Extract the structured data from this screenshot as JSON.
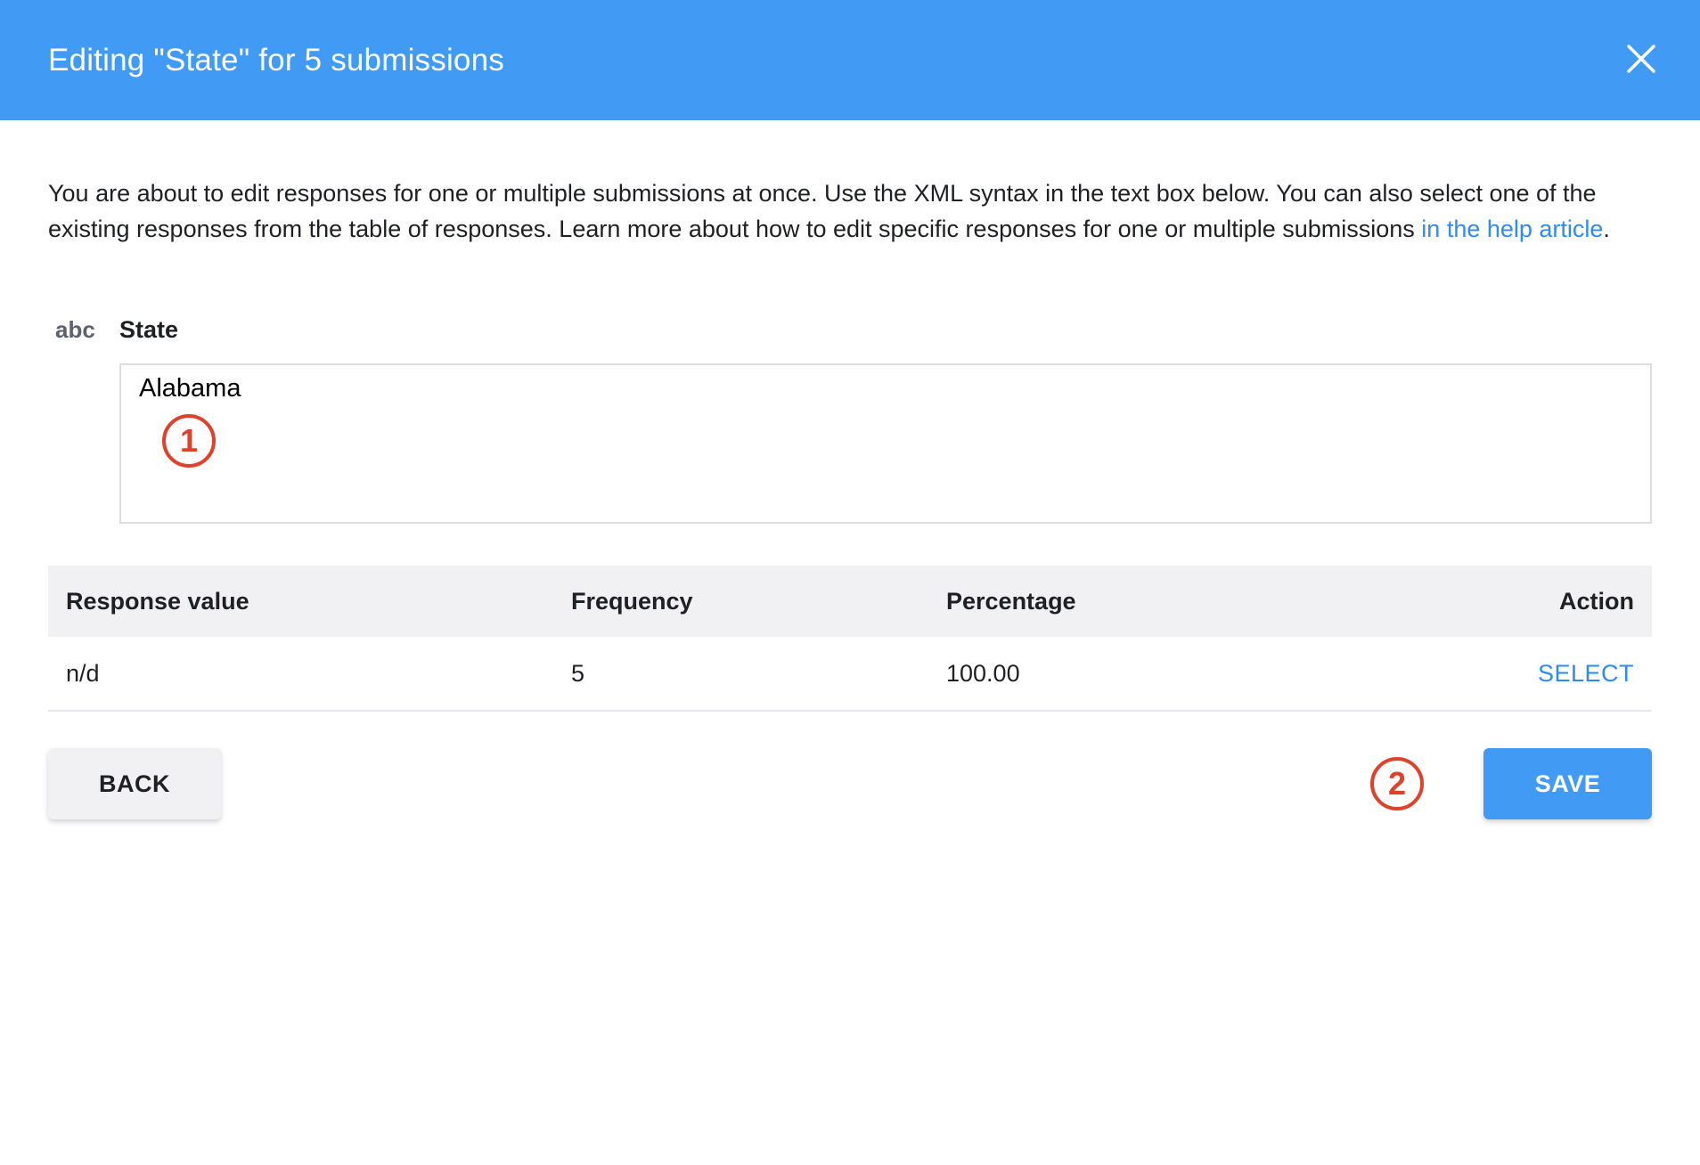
{
  "header": {
    "title": "Editing \"State\" for 5 submissions",
    "close_icon": "close-icon",
    "bg_color": "#419bf4"
  },
  "intro": {
    "text_before_link": "You are about to edit responses for one or multiple submissions at once. Use the XML syntax in the text box below. You can also select one of the existing responses from the table of responses. Learn more about how to edit specific responses for one or multiple submissions ",
    "link_text": "in the help article",
    "text_after_link": "."
  },
  "question": {
    "type_label": "abc",
    "label": "State"
  },
  "response_input": {
    "value": "Alabama"
  },
  "annotations": {
    "badge_1": "1",
    "badge_2": "2",
    "color": "#e0412b"
  },
  "table": {
    "headers": {
      "response_value": "Response value",
      "frequency": "Frequency",
      "percentage": "Percentage",
      "action": "Action"
    },
    "rows": [
      {
        "response_value": "n/d",
        "frequency": "5",
        "percentage": "100.00",
        "action": "SELECT"
      }
    ]
  },
  "buttons": {
    "back": "BACK",
    "save": "SAVE"
  }
}
